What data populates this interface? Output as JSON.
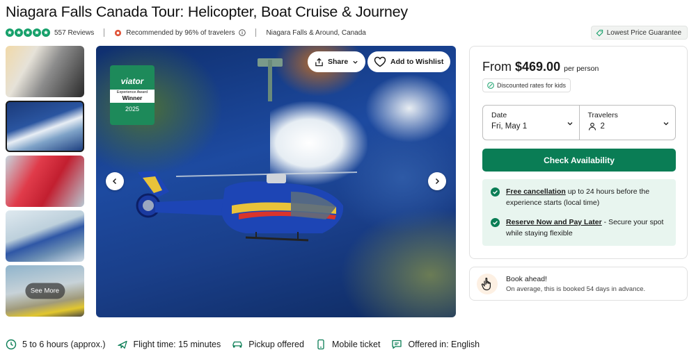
{
  "title": "Niagara Falls Canada Tour: Helicopter, Boat Cruise & Journey",
  "rating": {
    "stars": 5,
    "reviews": "557 Reviews"
  },
  "recommended": "Recommended by 96% of travelers",
  "location": "Niagara Falls & Around, Canada",
  "badge_price": "Lowest Price Guarantee",
  "gallery": {
    "see_more": "See More"
  },
  "award": {
    "brand": "viator",
    "line1": "Experience Award",
    "line2": "Winner",
    "year": "2025"
  },
  "hero_buttons": {
    "share": "Share",
    "wishlist": "Add to Wishlist"
  },
  "booking": {
    "from_label": "From",
    "price": "$469.00",
    "per": "per person",
    "kids": "Discounted rates for kids",
    "date_label": "Date",
    "date_value": "Fri, May 1",
    "travelers_label": "Travelers",
    "travelers_value": "2",
    "cta": "Check Availability",
    "perks": [
      {
        "title": "Free cancellation",
        "text": " up to 24 hours before the experience starts (local time)"
      },
      {
        "title": "Reserve Now and Pay Later",
        "text": " - Secure your spot while staying flexible"
      }
    ]
  },
  "book_ahead": {
    "title": "Book ahead!",
    "subtitle": "On average, this is booked 54 days in advance."
  },
  "features": [
    {
      "icon": "clock-icon",
      "label": "5 to 6 hours (approx.)"
    },
    {
      "icon": "plane-icon",
      "label": "Flight time: 15 minutes"
    },
    {
      "icon": "car-icon",
      "label": "Pickup offered"
    },
    {
      "icon": "phone-icon",
      "label": "Mobile ticket"
    },
    {
      "icon": "chat-icon",
      "label": "Offered in: English"
    }
  ],
  "colors": {
    "brand_green": "#0a7d55",
    "star_green": "#15a06a",
    "perk_bg": "#e8f5ef"
  }
}
